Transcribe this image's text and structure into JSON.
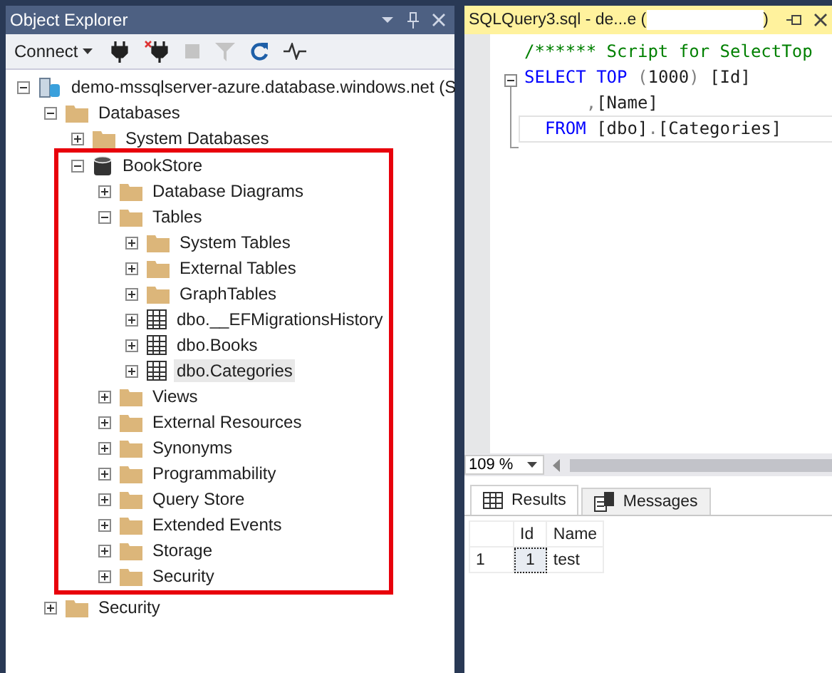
{
  "explorer": {
    "title": "Object Explorer",
    "connect": "Connect",
    "tree": [
      {
        "label": "demo-mssqlserver-azure.database.windows.net (S",
        "kind": "server",
        "expanded": true,
        "selected": false,
        "children": [
          {
            "label": "Databases",
            "kind": "folder",
            "expanded": true,
            "selected": false,
            "children": [
              {
                "label": "System Databases",
                "kind": "folder",
                "expanded": false,
                "selected": false
              },
              {
                "label": "BookStore",
                "kind": "database",
                "expanded": true,
                "selected": false,
                "highlighted": true,
                "children": [
                  {
                    "label": "Database Diagrams",
                    "kind": "folder",
                    "expanded": false,
                    "selected": false
                  },
                  {
                    "label": "Tables",
                    "kind": "folder",
                    "expanded": true,
                    "selected": false,
                    "children": [
                      {
                        "label": "System Tables",
                        "kind": "folder",
                        "expanded": false,
                        "selected": false
                      },
                      {
                        "label": "External Tables",
                        "kind": "folder",
                        "expanded": false,
                        "selected": false
                      },
                      {
                        "label": "GraphTables",
                        "kind": "folder",
                        "expanded": false,
                        "selected": false
                      },
                      {
                        "label": "dbo.__EFMigrationsHistory",
                        "kind": "table",
                        "expanded": false,
                        "selected": false
                      },
                      {
                        "label": "dbo.Books",
                        "kind": "table",
                        "expanded": false,
                        "selected": false
                      },
                      {
                        "label": "dbo.Categories",
                        "kind": "table",
                        "expanded": false,
                        "selected": true
                      }
                    ]
                  },
                  {
                    "label": "Views",
                    "kind": "folder",
                    "expanded": false,
                    "selected": false
                  },
                  {
                    "label": "External Resources",
                    "kind": "folder",
                    "expanded": false,
                    "selected": false
                  },
                  {
                    "label": "Synonyms",
                    "kind": "folder",
                    "expanded": false,
                    "selected": false
                  },
                  {
                    "label": "Programmability",
                    "kind": "folder",
                    "expanded": false,
                    "selected": false
                  },
                  {
                    "label": "Query Store",
                    "kind": "folder",
                    "expanded": false,
                    "selected": false
                  },
                  {
                    "label": "Extended Events",
                    "kind": "folder",
                    "expanded": false,
                    "selected": false
                  },
                  {
                    "label": "Storage",
                    "kind": "folder",
                    "expanded": false,
                    "selected": false
                  },
                  {
                    "label": "Security",
                    "kind": "folder",
                    "expanded": false,
                    "selected": false
                  }
                ]
              }
            ]
          },
          {
            "label": "Security",
            "kind": "folder",
            "expanded": false,
            "selected": false
          }
        ]
      }
    ]
  },
  "editor": {
    "tab_title": "SQLQuery3.sql - de...e (",
    "tab_title_end": ")",
    "lines": [
      {
        "tokens": [
          {
            "kind": "comment",
            "text": "/****** Script for SelectTop"
          }
        ]
      },
      {
        "tokens": [
          {
            "kind": "keyword",
            "text": "SELECT TOP "
          },
          {
            "kind": "punct",
            "text": "("
          },
          {
            "kind": "text",
            "text": "1000"
          },
          {
            "kind": "punct",
            "text": ")"
          },
          {
            "kind": "text",
            "text": " [Id]"
          }
        ]
      },
      {
        "tokens": [
          {
            "kind": "punct",
            "text": ","
          },
          {
            "kind": "text",
            "text": "[Name]"
          }
        ]
      },
      {
        "tokens": [
          {
            "kind": "keyword",
            "text": "FROM "
          },
          {
            "kind": "text",
            "text": "[dbo]"
          },
          {
            "kind": "punct",
            "text": "."
          },
          {
            "kind": "text",
            "text": "[Categories]"
          }
        ]
      }
    ],
    "zoom": "109 %"
  },
  "results": {
    "tabs": [
      {
        "label": "Results",
        "kind": "grid",
        "selected": true
      },
      {
        "label": "Messages",
        "kind": "messages",
        "selected": false
      }
    ],
    "columns": [
      "Id",
      "Name"
    ],
    "rows": [
      {
        "number": "1",
        "cells": [
          {
            "text": "1",
            "selected": true
          },
          {
            "text": "test",
            "selected": false
          }
        ]
      }
    ]
  }
}
